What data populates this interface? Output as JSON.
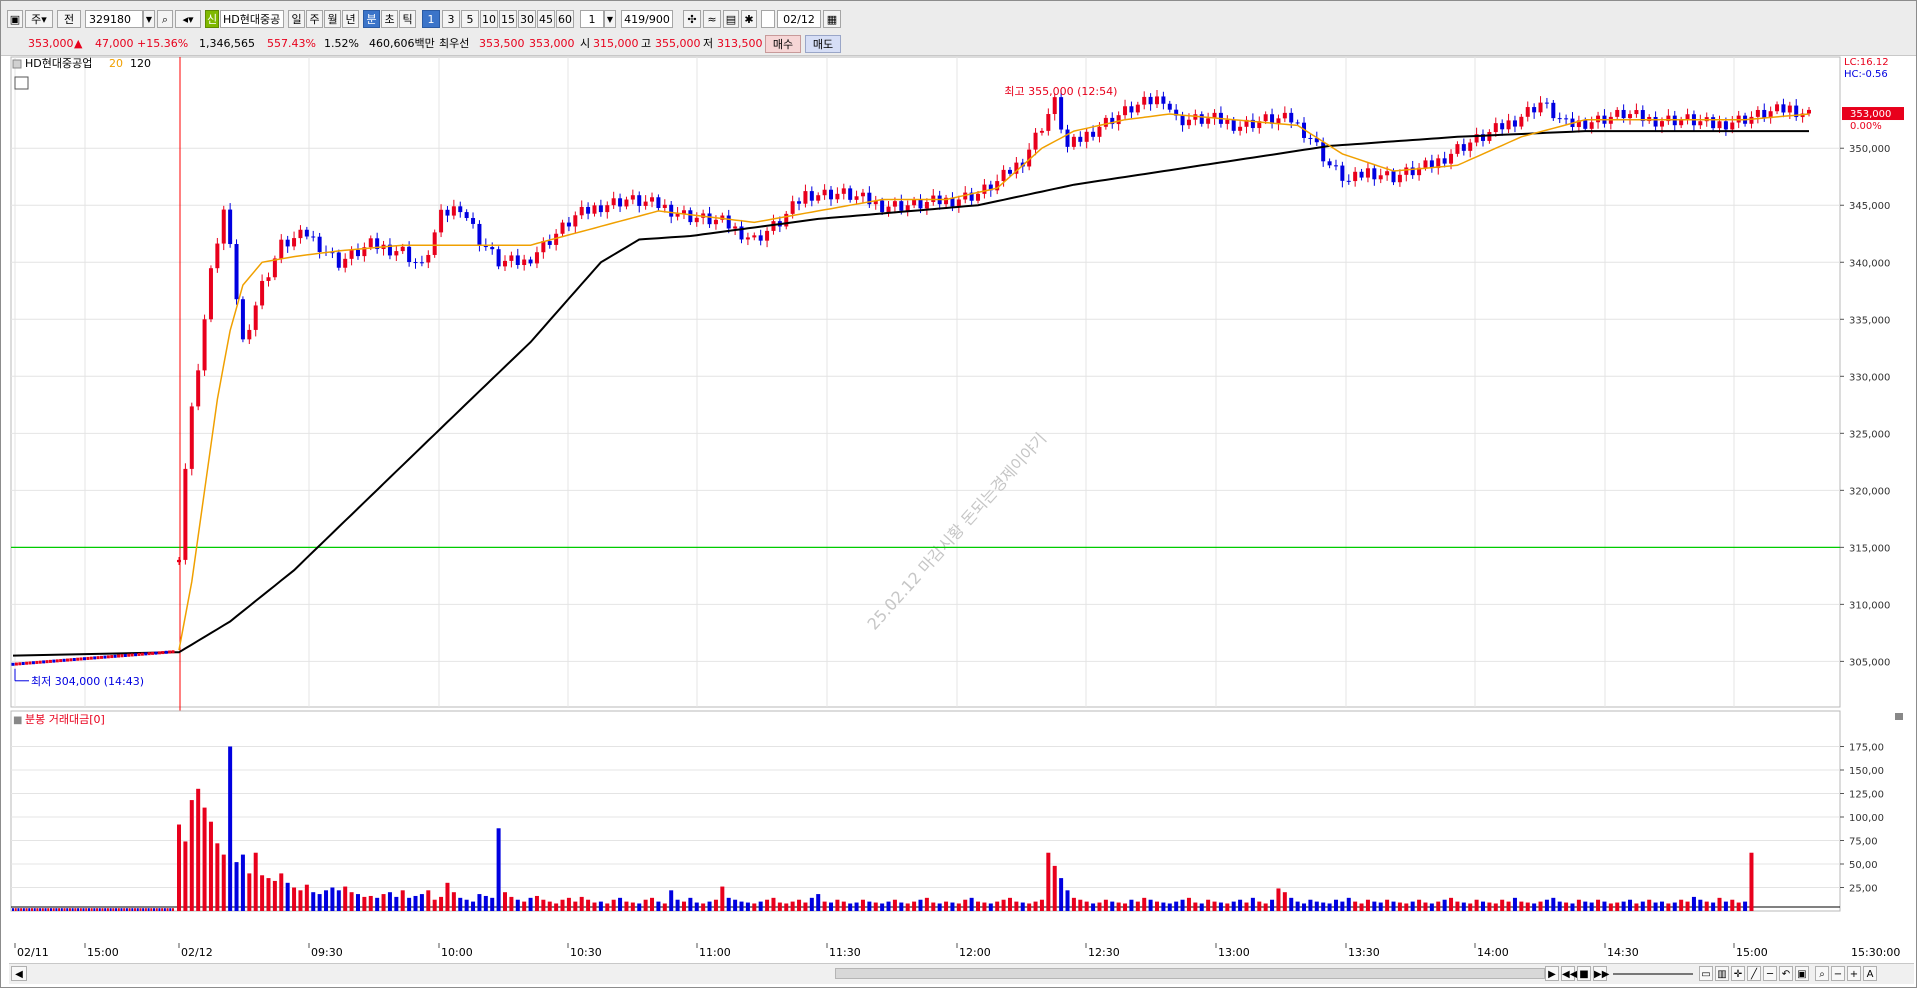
{
  "toolbar": {
    "mode_label": "주",
    "prev_label": "전",
    "code_value": "329180",
    "name_badge": "신",
    "name_value": "HD현대중공",
    "period_buttons": [
      "일",
      "주",
      "월",
      "년",
      "분",
      "초",
      "틱"
    ],
    "interval_buttons": [
      "1",
      "3",
      "5",
      "10",
      "15",
      "30",
      "45",
      "60"
    ],
    "interval_value": "1",
    "count_value": "419/900",
    "date_value": "02/12"
  },
  "quote": {
    "price": "353,000",
    "change_arrow": "▲",
    "change": "47,000",
    "change_pct": "+15.36%",
    "volume": "1,346,565",
    "volume_ratio": "557.43%",
    "turnover_pct": "1.52%",
    "trade_value": "460,606백만",
    "best_label": "최우선",
    "best_ask": "353,500",
    "best_bid": "353,000",
    "open_label": "시",
    "open": "315,000",
    "high_label": "고",
    "high": "355,000",
    "low_label": "저",
    "low": "313,500",
    "buy_label": "매수",
    "sell_label": "매도"
  },
  "colors": {
    "up": "#e8001c",
    "down": "#0000e0",
    "ma20": "#f0a000",
    "ma120": "#000000",
    "ref_line": "#00cc00"
  },
  "watermark": "25.02.12 마감시황 돈되는경제이야기",
  "chart_data": [
    {
      "type": "candlestick",
      "title": "HD현대중공업",
      "legend": [
        {
          "name": "20",
          "color": "#f0a000"
        },
        {
          "name": "120",
          "color": "#000000"
        }
      ],
      "ylim": [
        301000,
        358000
      ],
      "y_ticks": [
        305000,
        310000,
        315000,
        320000,
        325000,
        330000,
        335000,
        340000,
        345000,
        350000
      ],
      "y_tick_labels": [
        "305,000",
        "310,000",
        "315,000",
        "320,000",
        "325,000",
        "330,000",
        "335,000",
        "340,000",
        "345,000",
        "350,000"
      ],
      "right_badge": {
        "lc": "LC:16.12",
        "hc": "HC:-0.56",
        "last": "353,000",
        "pct": "0.00%"
      },
      "reference_line": 315000,
      "annotations": {
        "high": "최고 355,000 (12:54)",
        "low": "최저 304,000 (14:43)"
      },
      "prev_day": {
        "label": "02/11",
        "start": 304700,
        "end": 305800
      },
      "ohlc_path": [
        [
          0,
          314500
        ],
        [
          1,
          322000
        ],
        [
          2,
          327000
        ],
        [
          3,
          331000
        ],
        [
          4,
          335000
        ],
        [
          5,
          339000
        ],
        [
          6,
          342000
        ],
        [
          7,
          344500
        ],
        [
          8,
          341000
        ],
        [
          9,
          337000
        ],
        [
          10,
          333000
        ],
        [
          13,
          338000
        ],
        [
          16,
          341500
        ],
        [
          20,
          342500
        ],
        [
          25,
          340000
        ],
        [
          30,
          341500
        ],
        [
          35,
          341000
        ],
        [
          38,
          339500
        ],
        [
          41,
          344000
        ],
        [
          44,
          345000
        ],
        [
          47,
          342000
        ],
        [
          50,
          340000
        ],
        [
          54,
          340000
        ],
        [
          58,
          342000
        ],
        [
          62,
          344000
        ],
        [
          66,
          345000
        ],
        [
          70,
          345500
        ],
        [
          75,
          345000
        ],
        [
          80,
          344000
        ],
        [
          85,
          343500
        ],
        [
          90,
          342000
        ],
        [
          94,
          343500
        ],
        [
          98,
          346000
        ],
        [
          104,
          346000
        ],
        [
          110,
          345000
        ],
        [
          115,
          345000
        ],
        [
          121,
          345500
        ],
        [
          125,
          346000
        ],
        [
          128,
          347000
        ],
        [
          132,
          349000
        ],
        [
          135,
          352000
        ],
        [
          137,
          354000
        ],
        [
          139,
          350000
        ],
        [
          144,
          352000
        ],
        [
          149,
          353500
        ],
        [
          154,
          354500
        ],
        [
          156,
          352500
        ],
        [
          162,
          352500
        ],
        [
          166,
          352000
        ],
        [
          170,
          352500
        ],
        [
          174,
          352500
        ],
        [
          177,
          351000
        ],
        [
          180,
          348500
        ],
        [
          183,
          347000
        ],
        [
          186,
          348000
        ],
        [
          190,
          347500
        ],
        [
          196,
          348500
        ],
        [
          200,
          350000
        ],
        [
          204,
          351000
        ],
        [
          209,
          352500
        ],
        [
          213,
          354000
        ],
        [
          217,
          352000
        ],
        [
          222,
          352500
        ],
        [
          226,
          353000
        ],
        [
          230,
          352500
        ],
        [
          236,
          352500
        ],
        [
          240,
          352000
        ],
        [
          244,
          352500
        ],
        [
          248,
          353000
        ],
        [
          252,
          353500
        ],
        [
          255,
          353000
        ]
      ],
      "ma20_path": [
        [
          0,
          306000
        ],
        [
          2,
          312000
        ],
        [
          4,
          320000
        ],
        [
          6,
          328000
        ],
        [
          8,
          334000
        ],
        [
          10,
          338000
        ],
        [
          13,
          340000
        ],
        [
          18,
          340500
        ],
        [
          25,
          341000
        ],
        [
          35,
          341500
        ],
        [
          45,
          341500
        ],
        [
          55,
          341500
        ],
        [
          65,
          343000
        ],
        [
          75,
          344500
        ],
        [
          90,
          343500
        ],
        [
          100,
          344500
        ],
        [
          110,
          345500
        ],
        [
          120,
          345500
        ],
        [
          128,
          346500
        ],
        [
          135,
          350000
        ],
        [
          140,
          351500
        ],
        [
          148,
          352500
        ],
        [
          155,
          353000
        ],
        [
          165,
          352500
        ],
        [
          175,
          352000
        ],
        [
          182,
          349500
        ],
        [
          190,
          348000
        ],
        [
          200,
          348500
        ],
        [
          210,
          351000
        ],
        [
          220,
          352500
        ],
        [
          232,
          352500
        ],
        [
          245,
          352500
        ],
        [
          255,
          353000
        ]
      ],
      "ma120_path": [
        [
          0,
          305800
        ],
        [
          8,
          308500
        ],
        [
          18,
          313000
        ],
        [
          30,
          319500
        ],
        [
          42,
          326000
        ],
        [
          55,
          333000
        ],
        [
          66,
          340000
        ],
        [
          72,
          342000
        ],
        [
          80,
          342300
        ],
        [
          100,
          343800
        ],
        [
          125,
          345000
        ],
        [
          140,
          346800
        ],
        [
          160,
          348500
        ],
        [
          180,
          350200
        ],
        [
          200,
          351000
        ],
        [
          220,
          351500
        ],
        [
          240,
          351500
        ],
        [
          255,
          351500
        ]
      ]
    },
    {
      "type": "bar",
      "title": "분봉 거래대금[0]",
      "ylim": [
        0,
        200
      ],
      "y_ticks": [
        25,
        50,
        75,
        100,
        125,
        150,
        175
      ],
      "y_tick_labels": [
        "25,00",
        "50,00",
        "75,00",
        "100,00",
        "125,00",
        "150,00",
        "175,00"
      ],
      "values": [
        92,
        74,
        118,
        130,
        110,
        95,
        72,
        60,
        175,
        52,
        60,
        40,
        62,
        38,
        35,
        32,
        40,
        30,
        25,
        22,
        28,
        20,
        18,
        22,
        25,
        22,
        26,
        20,
        18,
        15,
        16,
        14,
        18,
        20,
        15,
        22,
        14,
        16,
        18,
        22,
        12,
        15,
        30,
        20,
        14,
        12,
        10,
        18,
        16,
        14,
        88,
        20,
        15,
        12,
        10,
        14,
        16,
        12,
        10,
        8,
        12,
        14,
        10,
        15,
        12,
        9,
        10,
        8,
        12,
        14,
        10,
        9,
        8,
        12,
        14,
        10,
        8,
        22,
        12,
        10,
        14,
        9,
        8,
        10,
        12,
        26,
        14,
        12,
        10,
        9,
        8,
        10,
        12,
        14,
        9,
        8,
        10,
        12,
        9,
        14,
        18,
        10,
        9,
        12,
        10,
        8,
        9,
        12,
        10,
        9,
        8,
        10,
        12,
        9,
        8,
        10,
        12,
        14,
        9,
        8,
        10,
        9,
        8,
        12,
        14,
        10,
        9,
        8,
        10,
        12,
        14,
        10,
        9,
        8,
        10,
        12,
        62,
        48,
        35,
        22,
        14,
        12,
        10,
        8,
        9,
        12,
        10,
        9,
        8,
        12,
        10,
        14,
        12,
        10,
        9,
        8,
        10,
        12,
        14,
        9,
        8,
        12,
        10,
        9,
        8,
        10,
        12,
        9,
        14,
        10,
        8,
        12,
        24,
        20,
        14,
        10,
        8,
        12,
        10,
        9,
        8,
        12,
        10,
        14,
        10,
        8,
        12,
        10,
        9,
        12,
        10,
        9,
        8,
        10,
        12,
        9,
        8,
        10,
        12,
        14,
        10,
        9,
        8,
        12,
        10,
        9,
        8,
        12,
        10,
        14,
        10,
        9,
        8,
        10,
        12,
        14,
        10,
        9,
        8,
        12,
        10,
        9,
        12,
        10,
        8,
        9,
        10,
        12,
        8,
        10,
        12,
        9,
        10,
        8,
        9,
        12,
        10,
        15,
        12,
        10,
        9,
        14,
        10,
        12,
        9,
        10,
        62
      ],
      "up_indices_note": "red=up, blue=down"
    }
  ],
  "x_axis": {
    "labels": [
      "02/11",
      "15:00",
      "02/12",
      "09:30",
      "10:00",
      "10:30",
      "11:00",
      "11:30",
      "12:00",
      "12:30",
      "13:00",
      "13:30",
      "14:00",
      "14:30",
      "15:00"
    ],
    "end_label": "15:30:00"
  },
  "volume_header": {
    "marker": "■",
    "label": "분봉 거래대금[0]"
  },
  "scroll": {
    "left_arrow": "◀",
    "right_arrow": "▶"
  }
}
